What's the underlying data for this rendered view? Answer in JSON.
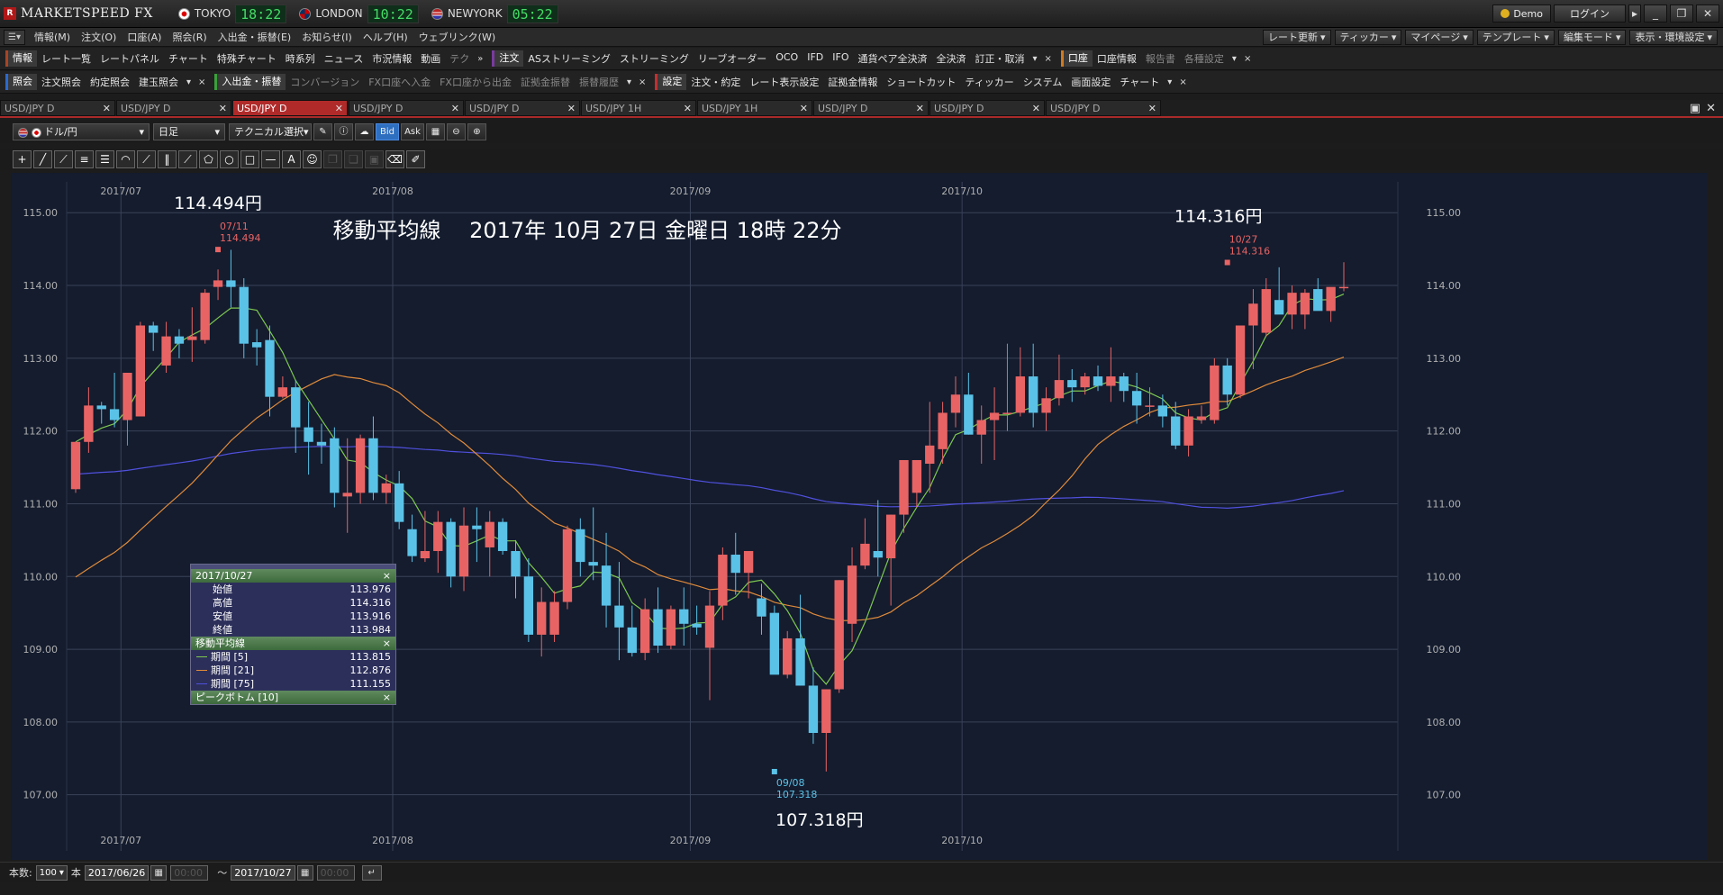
{
  "app": {
    "logo_text": "MARKETSPEED FX",
    "logo_mark": "R"
  },
  "clocks": [
    {
      "city": "TOKYO",
      "time": "18:22",
      "flag": "jp"
    },
    {
      "city": "LONDON",
      "time": "10:22",
      "flag": "uk"
    },
    {
      "city": "NEWYORK",
      "time": "05:22",
      "flag": "us"
    }
  ],
  "titlebar": {
    "demo": "Demo",
    "login": "ログイン",
    "min": "_",
    "max": "❐",
    "close": "✕"
  },
  "menu": {
    "items": [
      "情報(M)",
      "注文(O)",
      "口座(A)",
      "照会(R)",
      "入出金・振替(E)",
      "お知らせ(I)",
      "ヘルプ(H)",
      "ウェブリンク(W)"
    ],
    "right": [
      "レート更新",
      "ティッカー",
      "マイページ",
      "テンプレート",
      "編集モード",
      "表示・環境設定"
    ]
  },
  "toolbar1": {
    "group_info": "情報",
    "info_items": [
      "レート一覧",
      "レートパネル",
      "チャート",
      "特殊チャート",
      "時系列",
      "ニュース",
      "市況情報",
      "動画"
    ],
    "info_dim": "テク",
    "group_order": "注文",
    "order_items": [
      "ASストリーミング",
      "ストリーミング",
      "リーブオーダー",
      "OCO",
      "IFD",
      "IFO",
      "通貨ペア全決済",
      "全決済",
      "訂正・取消"
    ],
    "group_account": "口座",
    "account_items": [
      "口座情報"
    ],
    "account_dim": [
      "報告書",
      "各種設定"
    ]
  },
  "toolbar2": {
    "group_inq": "照会",
    "inq_items": [
      "注文照会",
      "約定照会",
      "建玉照会"
    ],
    "group_dep": "入出金・振替",
    "dep_dim": [
      "コンバージョン",
      "FX口座へ入金",
      "FX口座から出金",
      "証拠金振替",
      "振替履歴"
    ],
    "group_set": "設定",
    "set_items": [
      "注文・約定",
      "レート表示設定",
      "証拠金情報",
      "ショートカット",
      "ティッカー",
      "システム",
      "画面設定",
      "チャート"
    ]
  },
  "tabs": [
    {
      "label": "USD/JPY D"
    },
    {
      "label": "USD/JPY D"
    },
    {
      "label": "USD/JPY D",
      "active": true
    },
    {
      "label": "USD/JPY D"
    },
    {
      "label": "USD/JPY D"
    },
    {
      "label": "USD/JPY 1H"
    },
    {
      "label": "USD/JPY 1H"
    },
    {
      "label": "USD/JPY D"
    },
    {
      "label": "USD/JPY D"
    },
    {
      "label": "USD/JPY D"
    }
  ],
  "chart_toolbar": {
    "pair": "ドル/円",
    "period": "日足",
    "technical": "テクニカル選択",
    "bid": "Bid",
    "ask": "Ask"
  },
  "status": {
    "count_label": "本数:",
    "count": "100",
    "count_unit": "本",
    "from": "2017/06/26",
    "to": "2017/10/27",
    "from_time": "00:00",
    "to_time": "00:00",
    "tilde": "～"
  },
  "info_panel": {
    "date": "2017/10/27",
    "close": "×",
    "ohlc": [
      {
        "label": "始値",
        "value": "113.976"
      },
      {
        "label": "高値",
        "value": "114.316"
      },
      {
        "label": "安値",
        "value": "113.916"
      },
      {
        "label": "終値",
        "value": "113.984"
      }
    ],
    "ma_title": "移動平均線",
    "ma": [
      {
        "label": "期間 [5]",
        "value": "113.815",
        "color": "#7ec850"
      },
      {
        "label": "期間 [21]",
        "value": "112.876",
        "color": "#e08a3a"
      },
      {
        "label": "期間 [75]",
        "value": "111.155",
        "color": "#5050dd"
      }
    ],
    "peak_title": "ピークボトム [10]"
  },
  "chart_data": {
    "type": "candlestick",
    "title": "移動平均線　 2017年 10月 27日 金曜日 18時 22分",
    "ylim": [
      106.6,
      115.3
    ],
    "yticks": [
      "107.00",
      "108.00",
      "109.00",
      "110.00",
      "111.00",
      "112.00",
      "113.00",
      "114.00",
      "115.00"
    ],
    "xticks": [
      {
        "label": "2017/07",
        "index": 4
      },
      {
        "label": "2017/08",
        "index": 25
      },
      {
        "label": "2017/09",
        "index": 48
      },
      {
        "label": "2017/10",
        "index": 69
      }
    ],
    "colors": {
      "up": "#e86464",
      "down": "#5bc2e7",
      "ma5": "#7ec850",
      "ma21": "#e08a3a",
      "ma75": "#5050dd",
      "grid": "#3a4258",
      "axis": "#b0b0b0"
    },
    "high_label": {
      "index": 11,
      "date": "07/11",
      "value": "114.494",
      "big": "114.494円"
    },
    "low_label": {
      "index": 54,
      "date": "09/08",
      "value": "107.318",
      "big": "107.318円"
    },
    "last_label": {
      "index": 89,
      "date": "10/27",
      "value": "114.316",
      "big": "114.316円"
    },
    "candles": [
      [
        111.2,
        111.85,
        111.15,
        111.85
      ],
      [
        111.85,
        112.6,
        111.7,
        112.35
      ],
      [
        112.35,
        112.4,
        112.1,
        112.3
      ],
      [
        112.3,
        112.8,
        112.05,
        112.15
      ],
      [
        112.15,
        112.8,
        111.8,
        112.8
      ],
      [
        112.2,
        113.5,
        112.2,
        113.45
      ],
      [
        113.45,
        113.5,
        113.1,
        113.35
      ],
      [
        112.9,
        113.5,
        112.8,
        113.3
      ],
      [
        113.3,
        113.4,
        113.0,
        113.2
      ],
      [
        113.25,
        113.7,
        112.95,
        113.3
      ],
      [
        113.25,
        113.95,
        113.2,
        113.9
      ],
      [
        113.98,
        114.22,
        113.8,
        114.07
      ],
      [
        114.07,
        114.49,
        113.7,
        113.98
      ],
      [
        113.98,
        114.1,
        113.0,
        113.2
      ],
      [
        113.22,
        113.4,
        112.9,
        113.15
      ],
      [
        113.25,
        113.45,
        112.2,
        112.47
      ],
      [
        112.47,
        112.75,
        112.45,
        112.6
      ],
      [
        112.6,
        112.7,
        111.7,
        112.05
      ],
      [
        112.05,
        112.4,
        111.4,
        111.85
      ],
      [
        111.85,
        112.1,
        111.55,
        111.8
      ],
      [
        111.9,
        112.05,
        110.95,
        111.15
      ],
      [
        111.1,
        111.9,
        110.6,
        111.15
      ],
      [
        111.15,
        111.95,
        111.0,
        111.9
      ],
      [
        111.9,
        112.2,
        111.05,
        111.15
      ],
      [
        111.15,
        111.4,
        111.0,
        111.28
      ],
      [
        111.28,
        111.45,
        110.65,
        110.75
      ],
      [
        110.65,
        110.85,
        110.2,
        110.28
      ],
      [
        110.25,
        110.9,
        110.2,
        110.35
      ],
      [
        110.35,
        110.9,
        110.05,
        110.75
      ],
      [
        110.75,
        110.8,
        109.85,
        110.0
      ],
      [
        110.0,
        110.95,
        109.8,
        110.7
      ],
      [
        110.7,
        110.95,
        110.2,
        110.65
      ],
      [
        110.4,
        110.9,
        110.0,
        110.75
      ],
      [
        110.75,
        110.8,
        110.3,
        110.35
      ],
      [
        110.35,
        110.5,
        109.7,
        110.0
      ],
      [
        110.0,
        110.25,
        109.1,
        109.2
      ],
      [
        109.2,
        109.85,
        108.9,
        109.65
      ],
      [
        109.2,
        109.8,
        109.1,
        109.65
      ],
      [
        109.65,
        110.7,
        109.55,
        110.65
      ],
      [
        110.65,
        110.8,
        110.0,
        110.2
      ],
      [
        110.2,
        110.95,
        109.95,
        110.15
      ],
      [
        110.15,
        110.6,
        109.3,
        109.6
      ],
      [
        109.6,
        110.2,
        108.85,
        109.3
      ],
      [
        109.3,
        109.6,
        108.9,
        108.95
      ],
      [
        108.95,
        109.7,
        108.85,
        109.55
      ],
      [
        109.55,
        109.85,
        108.95,
        109.05
      ],
      [
        109.05,
        109.6,
        109.0,
        109.55
      ],
      [
        109.55,
        109.85,
        109.05,
        109.35
      ],
      [
        109.35,
        109.6,
        109.2,
        109.3
      ],
      [
        109.02,
        109.8,
        108.3,
        109.6
      ],
      [
        109.6,
        110.4,
        109.4,
        110.3
      ],
      [
        110.3,
        110.6,
        109.75,
        110.05
      ],
      [
        110.05,
        110.35,
        109.7,
        110.35
      ],
      [
        109.7,
        109.9,
        109.2,
        109.45
      ],
      [
        109.5,
        109.6,
        108.75,
        108.65
      ],
      [
        108.65,
        109.25,
        108.6,
        109.15
      ],
      [
        109.15,
        109.75,
        108.5,
        108.5
      ],
      [
        108.5,
        108.75,
        107.7,
        107.85
      ],
      [
        107.85,
        108.45,
        107.32,
        108.45
      ],
      [
        108.45,
        109.95,
        108.4,
        109.95
      ],
      [
        109.35,
        110.4,
        109.1,
        110.15
      ],
      [
        110.15,
        110.8,
        110.1,
        110.45
      ],
      [
        110.35,
        111.05,
        110.0,
        110.26
      ],
      [
        110.25,
        110.85,
        109.6,
        110.85
      ],
      [
        110.85,
        111.6,
        110.6,
        111.6
      ],
      [
        111.15,
        111.6,
        110.95,
        111.6
      ],
      [
        111.55,
        112.4,
        111.15,
        111.8
      ],
      [
        111.75,
        112.4,
        111.55,
        112.25
      ],
      [
        112.25,
        112.75,
        112.05,
        112.5
      ],
      [
        112.5,
        112.8,
        111.95,
        111.95
      ],
      [
        111.95,
        112.35,
        111.55,
        112.15
      ],
      [
        112.15,
        112.6,
        111.6,
        112.25
      ],
      [
        112.25,
        113.2,
        112.0,
        112.25
      ],
      [
        112.25,
        113.15,
        112.2,
        112.75
      ],
      [
        112.75,
        113.2,
        112.05,
        112.25
      ],
      [
        112.25,
        112.6,
        112.0,
        112.45
      ],
      [
        112.45,
        113.05,
        112.35,
        112.7
      ],
      [
        112.7,
        112.85,
        112.4,
        112.6
      ],
      [
        112.6,
        112.8,
        112.5,
        112.75
      ],
      [
        112.75,
        112.9,
        112.55,
        112.62
      ],
      [
        112.62,
        113.15,
        112.4,
        112.75
      ],
      [
        112.75,
        112.8,
        112.4,
        112.55
      ],
      [
        112.55,
        112.8,
        112.1,
        112.35
      ],
      [
        112.35,
        112.6,
        112.2,
        112.35
      ],
      [
        112.35,
        112.5,
        112.05,
        112.2
      ],
      [
        112.2,
        112.4,
        111.75,
        111.8
      ],
      [
        111.8,
        112.3,
        111.65,
        112.2
      ],
      [
        112.15,
        112.35,
        112.1,
        112.2
      ],
      [
        112.15,
        113.0,
        112.1,
        112.9
      ],
      [
        112.9,
        113.0,
        112.35,
        112.5
      ],
      [
        112.5,
        113.25,
        112.45,
        113.45
      ],
      [
        113.45,
        113.95,
        112.85,
        113.75
      ],
      [
        113.35,
        114.1,
        113.3,
        113.95
      ],
      [
        113.8,
        114.25,
        113.7,
        113.6
      ],
      [
        113.6,
        114.0,
        113.4,
        113.9
      ],
      [
        113.6,
        113.95,
        113.4,
        113.9
      ],
      [
        113.95,
        114.1,
        113.8,
        113.65
      ],
      [
        113.65,
        113.95,
        113.5,
        113.98
      ],
      [
        113.98,
        114.32,
        113.92,
        113.98
      ]
    ]
  }
}
